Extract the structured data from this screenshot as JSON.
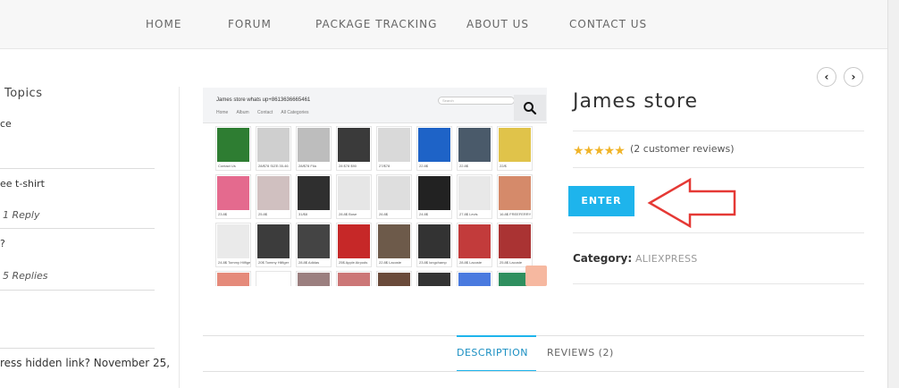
{
  "nav": {
    "items": [
      "HOME",
      "FORUM",
      "PACKAGE TRACKING",
      "ABOUT US",
      "CONTACT US"
    ]
  },
  "sidebar": {
    "title": "Topics",
    "entries": [
      {
        "text": "ce",
        "meta": ""
      },
      {
        "text": "ee t-shirt",
        "meta": "1 Reply"
      },
      {
        "text": "?",
        "meta": "5 Replies"
      },
      {
        "text": "ress hidden link? November 25,",
        "meta": ""
      }
    ]
  },
  "product_image": {
    "store_line": "James store whats up+8613636665461",
    "store_nav": [
      "Home",
      "Album",
      "Contact",
      "All Categories"
    ],
    "search_placeholder": "Search",
    "captions": [
      [
        "Contact Us",
        "28/$78 SIZE:35-46",
        "28/$78 Fila",
        "28 $78 $90",
        "27/$78",
        "22.8$",
        "22.8$",
        "22/$"
      ],
      [
        "23.8$",
        "25.8$",
        "31/$8",
        "28.8$ Bose",
        "26.8$",
        "24.8$",
        "27.8$ Levis",
        "16.8$ FREEFERRY"
      ],
      [
        "24.8$ Tommy Hilfiger",
        "20$ Tommy Hilfiger",
        "28.8$ Adidas",
        "25$ Apple Airpods",
        "22.8$ Lacoste",
        "23.8$ longchamp",
        "28.8$ Lacoste",
        "25.8$ Lacoste"
      ]
    ]
  },
  "product": {
    "title": "James store",
    "stars": "★★★★★",
    "reviews": "(2 customer reviews)",
    "enter_label": "ENTER",
    "category_label": "Category:",
    "category_value": "ALIEXPRESS",
    "prev_arrow": "‹",
    "next_arrow": "›"
  },
  "tabs": {
    "description": "DESCRIPTION",
    "reviews": "REVIEWS (2)"
  },
  "colors": {
    "accent": "#1eb4ec",
    "star": "#f0b429",
    "annotation_arrow": "#e53935"
  }
}
